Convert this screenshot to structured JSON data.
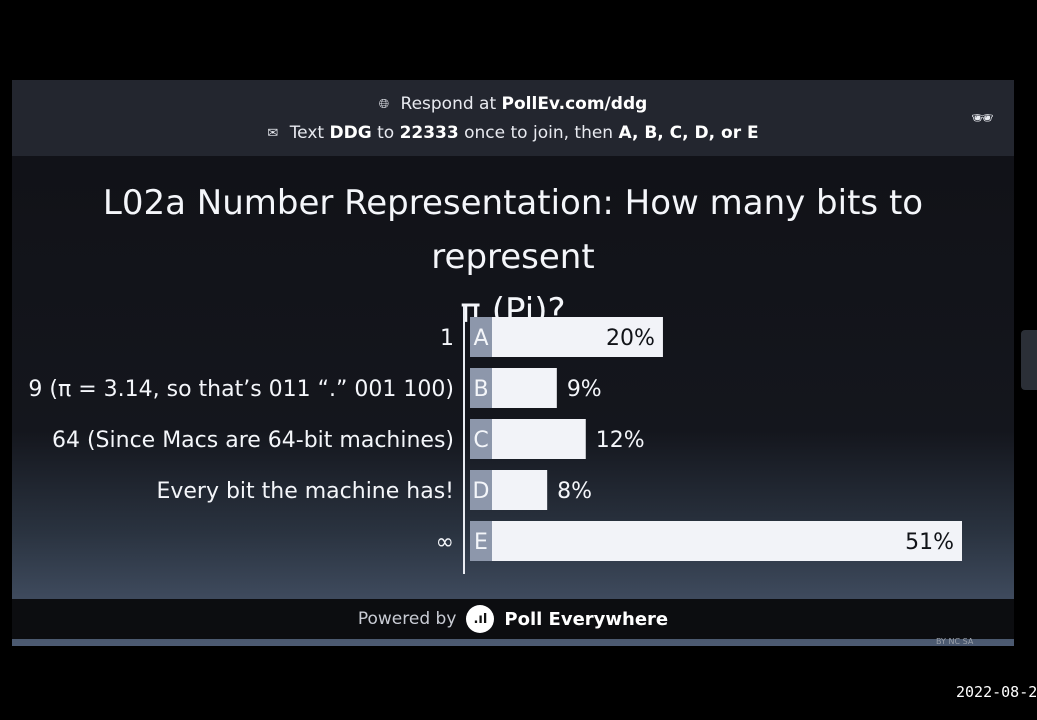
{
  "header": {
    "respond_prefix": "Respond at",
    "respond_url": "PollEv.com/ddg",
    "text_prefix": "Text",
    "text_code": "DDG",
    "text_to": "to",
    "text_number": "22333",
    "text_suffix": "once to join, then",
    "text_options": "A, B, C, D, or E"
  },
  "question": {
    "line1": "L02a Number Representation: How many bits to represent",
    "line2": "π (Pi)?"
  },
  "chart_data": {
    "type": "bar",
    "orientation": "horizontal",
    "categories": [
      "1",
      "9 (π = 3.14, so that’s 011 “.” 001 100)",
      "64 (Since Macs are 64-bit machines)",
      "Every bit the machine has!",
      "∞"
    ],
    "letters": [
      "A",
      "B",
      "C",
      "D",
      "E"
    ],
    "values": [
      20,
      9,
      12,
      8,
      51
    ],
    "value_labels": [
      "20%",
      "9%",
      "12%",
      "8%",
      "51%"
    ],
    "xlim": [
      0,
      51
    ],
    "bar_color": "#f2f3f8",
    "letter_color": "#8d97ab"
  },
  "footer": {
    "powered_by": "Powered by",
    "brand": "Poll Everywhere"
  },
  "timestamp": "2022-08-2",
  "cc_text": "BY NC SA"
}
